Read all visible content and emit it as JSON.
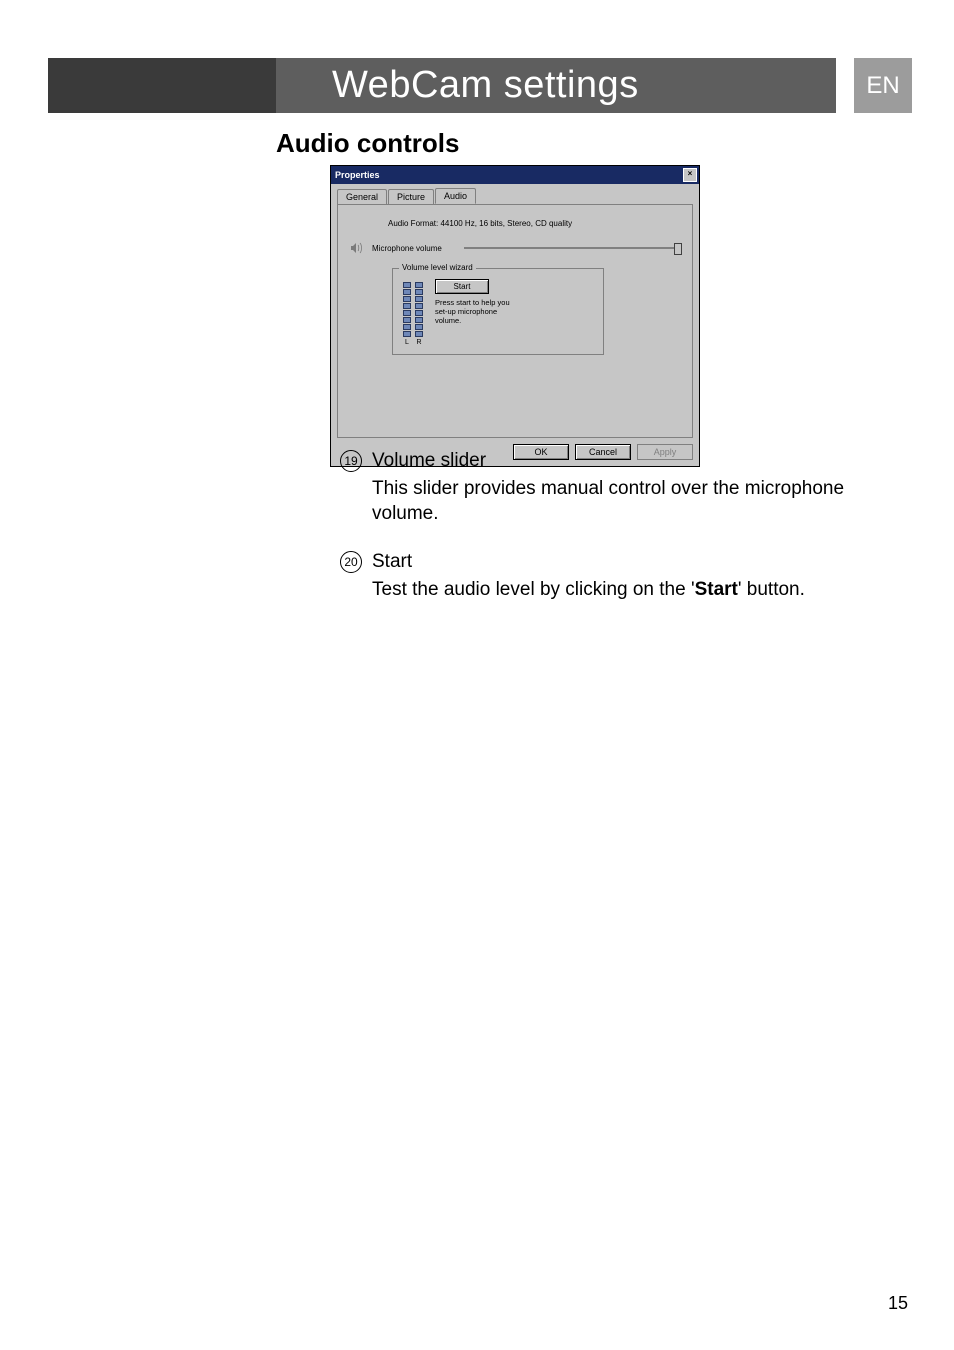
{
  "header": {
    "section_title": "WebCam settings",
    "language_badge": "EN"
  },
  "subheading": "Audio controls",
  "screenshot": {
    "window_title": "Properties",
    "close_glyph": "×",
    "tabs": {
      "general": "General",
      "picture": "Picture",
      "audio": "Audio"
    },
    "audio_format": "Audio Format: 44100 Hz, 16 bits, Stereo, CD quality",
    "mic_volume_label": "Microphone volume",
    "wizard": {
      "legend": "Volume level wizard",
      "start_button": "Start",
      "help_text": "Press start to help you set-up microphone volume.",
      "meter_left": "L",
      "meter_right": "R"
    },
    "buttons": {
      "ok": "OK",
      "cancel": "Cancel",
      "apply": "Apply"
    }
  },
  "callouts": {
    "n19": "19",
    "n20": "20"
  },
  "entries": [
    {
      "num": "19",
      "title": "Volume slider",
      "desc_plain": "This slider provides manual control over the microphone volume."
    },
    {
      "num": "20",
      "title": "Start",
      "desc_pre": "Test the audio level by clicking on the '",
      "desc_bold": "Start",
      "desc_post": "' button."
    }
  ],
  "page_number": "15"
}
